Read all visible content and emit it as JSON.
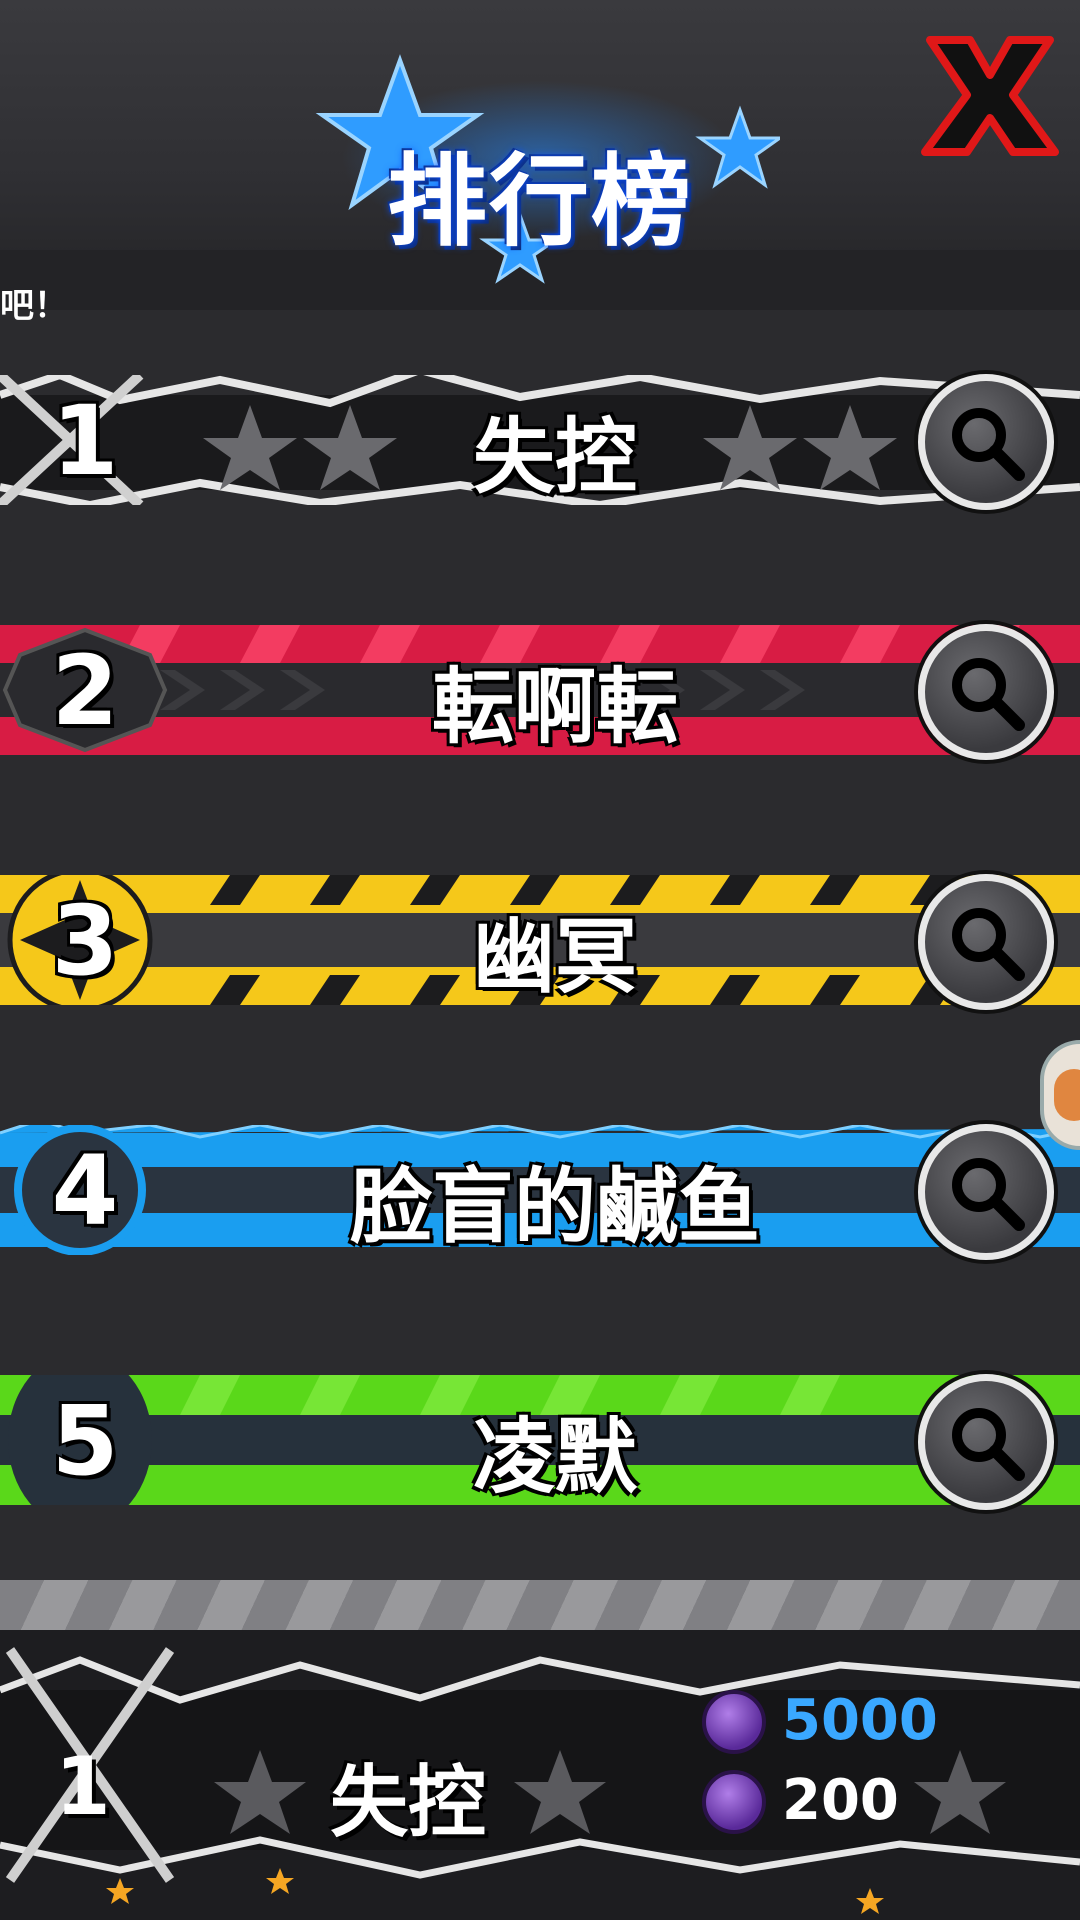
{
  "header": {
    "title": "排行榜",
    "close_icon": "close-x-icon",
    "hint_text": "吧！"
  },
  "leaderboard": [
    {
      "rank": "1",
      "name": "失控",
      "style": "silver-lightning"
    },
    {
      "rank": "2",
      "name": "転啊転",
      "style": "red-stripes"
    },
    {
      "rank": "3",
      "name": "幽冥",
      "style": "yellow-stripes"
    },
    {
      "rank": "4",
      "name": "脸盲的鹹鱼",
      "style": "blue-spiky"
    },
    {
      "rank": "5",
      "name": "凌默",
      "style": "green-plain"
    }
  ],
  "self": {
    "rank": "1",
    "name": "失控",
    "currency_primary": "5000",
    "currency_secondary": "200"
  },
  "colors": {
    "title_glow": "#2b8cff",
    "close_red": "#e01818",
    "rank2": "#e8224a",
    "rank3": "#f8d020",
    "rank4": "#1aa0f0",
    "rank5": "#5ee01a",
    "currency_blue": "#3aa8ff"
  }
}
